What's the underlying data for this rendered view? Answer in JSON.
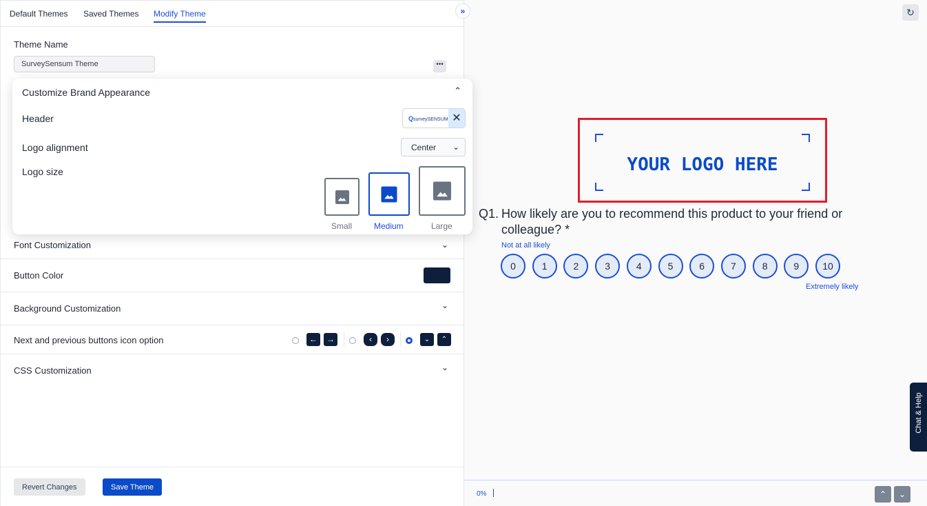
{
  "tabs": [
    {
      "label": "Default Themes"
    },
    {
      "label": "Saved Themes"
    },
    {
      "label": "Modify Theme",
      "active": true
    }
  ],
  "theme_name": {
    "label": "Theme Name",
    "value": "SurveySensum Theme"
  },
  "brand": {
    "title": "Customize Brand Appearance",
    "header_label": "Header",
    "header_logo_text": "surveySENSUM",
    "logo_alignment_label": "Logo alignment",
    "logo_alignment_value": "Center",
    "logo_size_label": "Logo size",
    "sizes": [
      {
        "label": "Small"
      },
      {
        "label": "Medium",
        "selected": true
      },
      {
        "label": "Large"
      }
    ]
  },
  "sections": {
    "font": "Font Customization",
    "button_color": "Button Color",
    "button_color_value": "#0d1f3c",
    "background": "Background Customization",
    "nav_icons": "Next and previous buttons icon option",
    "nav_icons_selected": 3,
    "css": "CSS Customization"
  },
  "footer": {
    "revert": "Revert Changes",
    "save": "Save Theme"
  },
  "preview": {
    "logo_placeholder": "YOUR LOGO HERE",
    "question_number": "Q1.",
    "question_text": "How likely are you to recommend this product to your friend or colleague? *",
    "low_label": "Not at all likely",
    "high_label": "Extremely likely",
    "options": [
      "0",
      "1",
      "2",
      "3",
      "4",
      "5",
      "6",
      "7",
      "8",
      "9",
      "10"
    ],
    "progress": "0%",
    "chat": "Chat & Help"
  },
  "colors": {
    "accent": "#1d4ed8",
    "highlight": "#e11d2a",
    "dark": "#0d1f3c"
  }
}
